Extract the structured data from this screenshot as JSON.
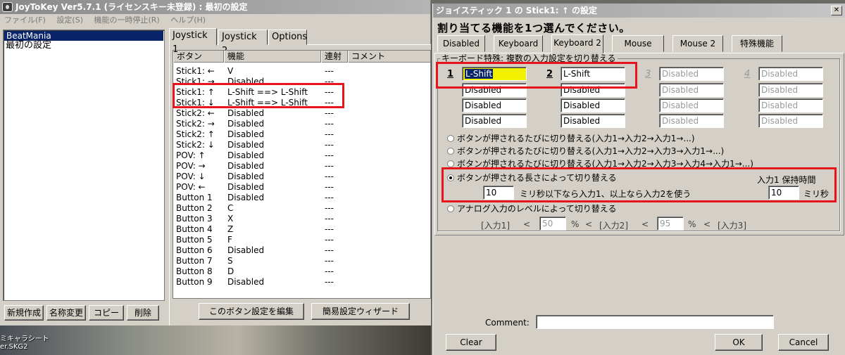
{
  "main_window": {
    "title": "JoyToKey Ver5.7.1 (ライセンスキー未登録) : 最初の設定",
    "menu": [
      "ファイル(F)",
      "設定(S)",
      "機能の一時停止(R)",
      "ヘルプ(H)"
    ],
    "profiles": [
      "BeatMania",
      "最初の設定"
    ],
    "profile_buttons": [
      "新規作成",
      "名称変更",
      "コピー",
      "削除"
    ],
    "tabs": [
      "Joystick 1",
      "Joystick 2",
      "Options"
    ],
    "columns": [
      "ボタン",
      "機能",
      "連射",
      "コメント"
    ],
    "rows": [
      {
        "button": "Stick1: ←",
        "func": "V",
        "rapid": "---"
      },
      {
        "button": "Stick1: →",
        "func": "Disabled",
        "rapid": "---"
      },
      {
        "button": "Stick1: ↑",
        "func": "L-Shift ==> L-Shift",
        "rapid": "---"
      },
      {
        "button": "Stick1: ↓",
        "func": "L-Shift ==> L-Shift",
        "rapid": "---"
      },
      {
        "button": "Stick2: ←",
        "func": "Disabled",
        "rapid": "---"
      },
      {
        "button": "Stick2: →",
        "func": "Disabled",
        "rapid": "---"
      },
      {
        "button": "Stick2: ↑",
        "func": "Disabled",
        "rapid": "---"
      },
      {
        "button": "Stick2: ↓",
        "func": "Disabled",
        "rapid": "---"
      },
      {
        "button": "POV: ↑",
        "func": "Disabled",
        "rapid": "---"
      },
      {
        "button": "POV: →",
        "func": "Disabled",
        "rapid": "---"
      },
      {
        "button": "POV: ↓",
        "func": "Disabled",
        "rapid": "---"
      },
      {
        "button": "POV: ←",
        "func": "Disabled",
        "rapid": "---"
      },
      {
        "button": "Button 1",
        "func": "Disabled",
        "rapid": "---"
      },
      {
        "button": "Button 2",
        "func": "C",
        "rapid": "---"
      },
      {
        "button": "Button 3",
        "func": "X",
        "rapid": "---"
      },
      {
        "button": "Button 4",
        "func": "Z",
        "rapid": "---"
      },
      {
        "button": "Button 5",
        "func": "F",
        "rapid": "---"
      },
      {
        "button": "Button 6",
        "func": "Disabled",
        "rapid": "---"
      },
      {
        "button": "Button 7",
        "func": "S",
        "rapid": "---"
      },
      {
        "button": "Button 8",
        "func": "D",
        "rapid": "---"
      },
      {
        "button": "Button 9",
        "func": "Disabled",
        "rapid": "---"
      }
    ],
    "edit_button": "このボタン設定を編集",
    "wizard_button": "簡易設定ウィザード"
  },
  "desktop": {
    "icon_label_line1": "ミキャラシート",
    "icon_label_line2": "er.SKG2"
  },
  "dialog": {
    "title": "ジョイスティック 1 の Stick1: ↑ の設定",
    "heading": "割り当てる機能を1つ選んでください。",
    "tabs": [
      "Disabled",
      "Keyboard",
      "Keyboard 2",
      "Mouse",
      "Mouse 2",
      "特殊機能"
    ],
    "group_label": "キーボード特殊: 複数の入力設定を切り替える",
    "slots": [
      {
        "num": "1",
        "values": [
          "L-Shift",
          "Disabled",
          "Disabled",
          "Disabled"
        ]
      },
      {
        "num": "2",
        "values": [
          "L-Shift",
          "Disabled",
          "Disabled",
          "Disabled"
        ]
      },
      {
        "num": "3",
        "values": [
          "Disabled",
          "Disabled",
          "Disabled",
          "Disabled"
        ]
      },
      {
        "num": "4",
        "values": [
          "Disabled",
          "Disabled",
          "Disabled",
          "Disabled"
        ]
      }
    ],
    "radios": [
      "ボタンが押されるたびに切り替える(入力1→入力2→入力1→...)",
      "ボタンが押されるたびに切り替える(入力1→入力2→入力3→入力1→...)",
      "ボタンが押されるたびに切り替える(入力1→入力2→入力3→入力4→入力1→...)",
      "ボタンが押される長さによって切り替える",
      "アナログ入力のレベルによって切り替える"
    ],
    "hold_time_label": "入力1 保持時間",
    "press_ms_value": "10",
    "press_ms_text": "ミリ秒以下なら入力1、以上なら入力2を使う",
    "hold_ms_value": "10",
    "hold_ms_unit": "ミリ秒",
    "analog_input1": "[入力1]",
    "analog_lt1": "<",
    "analog_val1": "50",
    "analog_pct1": "%",
    "analog_lt2": "<",
    "analog_input2": "[入力2]",
    "analog_lt3": "<",
    "analog_val2": "95",
    "analog_pct2": "%",
    "analog_lt4": "<",
    "analog_input3": "[入力3]",
    "comment_label": "Comment:",
    "comment_value": "",
    "clear_button": "Clear",
    "ok_button": "OK",
    "cancel_button": "Cancel",
    "close_glyph": "✕"
  },
  "colors": {
    "highlight_box": "#e8141b",
    "selection": "#0a246a",
    "focus_field": "#f2f200"
  }
}
